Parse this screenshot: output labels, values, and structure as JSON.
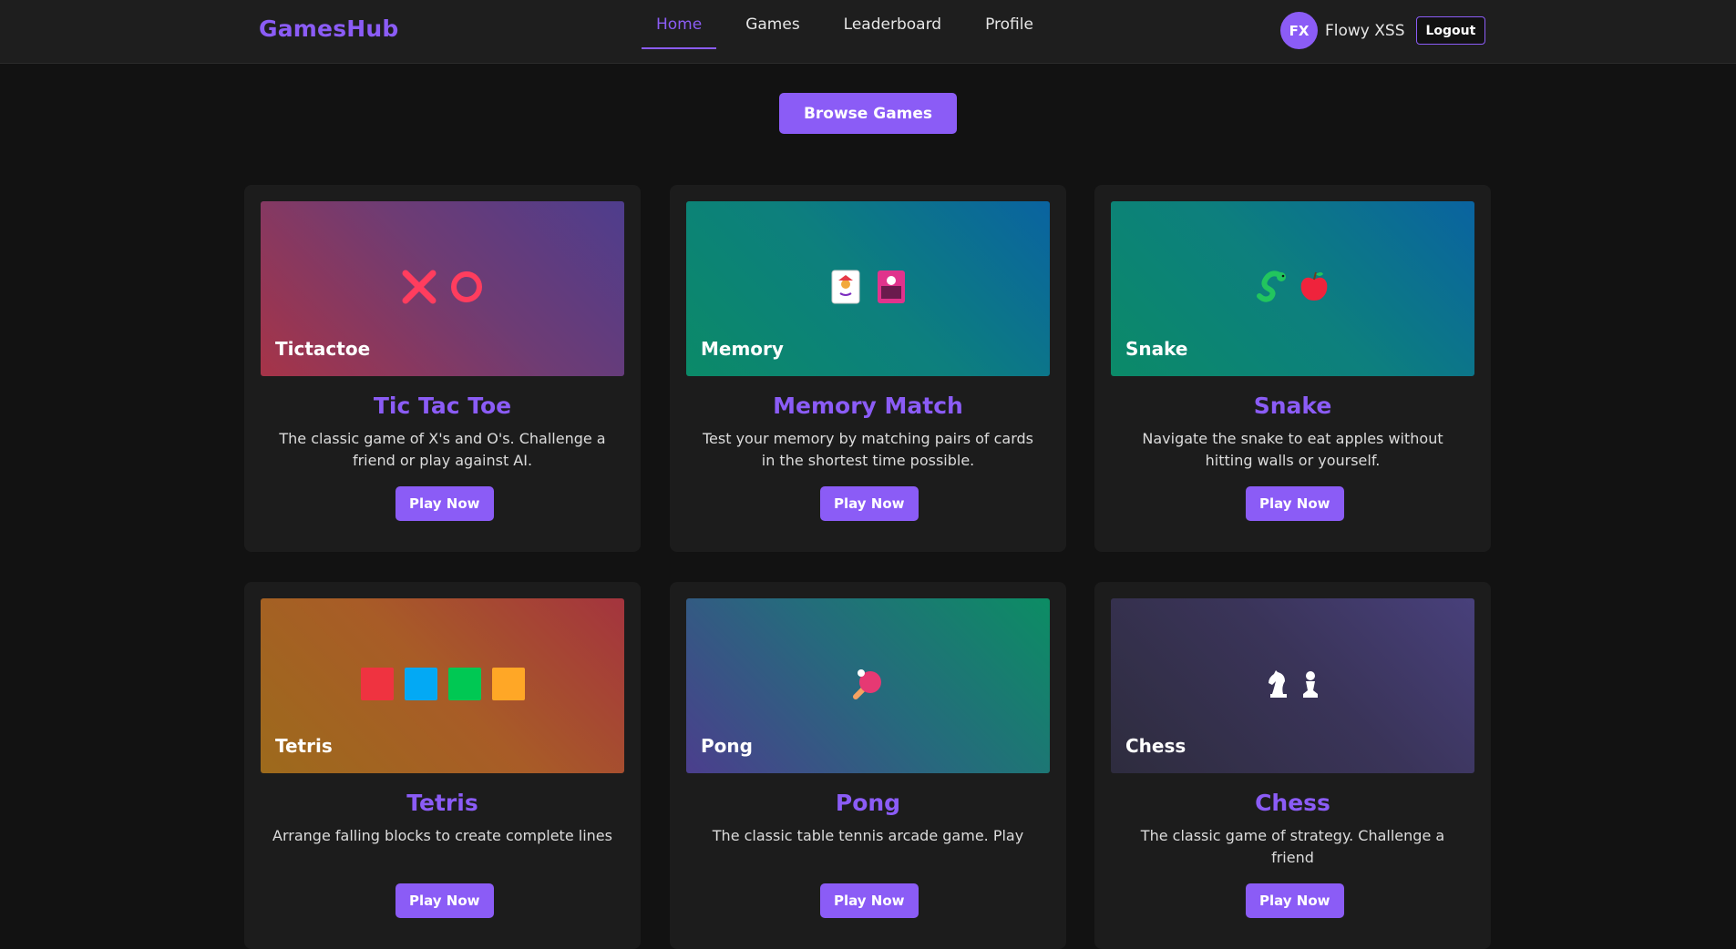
{
  "header": {
    "brand": "GamesHub",
    "nav": [
      "Home",
      "Games",
      "Leaderboard",
      "Profile"
    ],
    "active_nav": "Home",
    "user": {
      "initials": "FX",
      "name": "Flowy XSS"
    },
    "logout_label": "Logout"
  },
  "browse_label": "Browse Games",
  "colors": {
    "accent": "#8b5cf6",
    "background": "#121212",
    "card": "#1c1c1c"
  },
  "cards": [
    {
      "label": "Tictactoe",
      "title": "Tic Tac Toe",
      "description": "The classic game of X's and O's. Challenge a friend or play against AI.",
      "button": "Play Now",
      "icons": [
        "x-mark-icon",
        "circle-icon"
      ]
    },
    {
      "label": "Memory",
      "title": "Memory Match",
      "description": "Test your memory by matching pairs of cards in the shortest time possible.",
      "button": "Play Now",
      "icons": [
        "joker-card-icon",
        "flower-card-icon"
      ]
    },
    {
      "label": "Snake",
      "title": "Snake",
      "description": "Navigate the snake to eat apples without hitting walls or yourself.",
      "button": "Play Now",
      "icons": [
        "snake-icon",
        "apple-icon"
      ]
    },
    {
      "label": "Tetris",
      "title": "Tetris",
      "description": "Arrange falling blocks to create complete lines",
      "button": "Play Now",
      "icons": [
        "red-block-icon",
        "blue-block-icon",
        "green-block-icon",
        "orange-block-icon"
      ]
    },
    {
      "label": "Pong",
      "title": "Pong",
      "description": "The classic table tennis arcade game. Play",
      "button": "Play Now",
      "icons": [
        "ping-pong-icon"
      ]
    },
    {
      "label": "Chess",
      "title": "Chess",
      "description": "The classic game of strategy. Challenge a friend",
      "button": "Play Now",
      "icons": [
        "knight-icon",
        "pawn-icon"
      ]
    }
  ]
}
